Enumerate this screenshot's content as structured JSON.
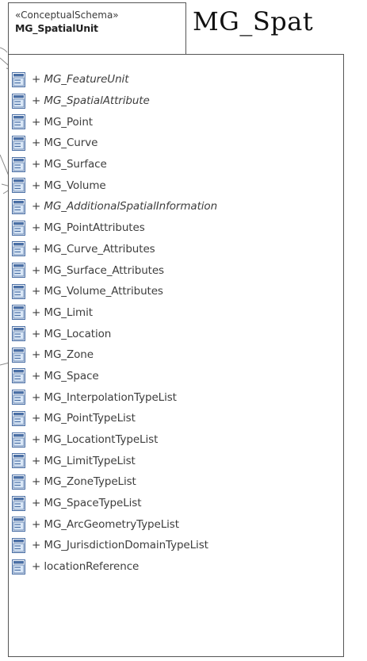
{
  "diagram_title": "MG_Spat",
  "package": {
    "stereotype": "«ConceptualSchema»",
    "name": "MG_SpatialUnit"
  },
  "elements": [
    {
      "label": "+ MG_FeatureUnit",
      "abstract": true
    },
    {
      "label": "+ MG_SpatialAttribute",
      "abstract": true
    },
    {
      "label": "+ MG_Point",
      "abstract": false
    },
    {
      "label": "+ MG_Curve",
      "abstract": false
    },
    {
      "label": "+ MG_Surface",
      "abstract": false
    },
    {
      "label": "+ MG_Volume",
      "abstract": false
    },
    {
      "label": "+ MG_AdditionalSpatialInformation",
      "abstract": true
    },
    {
      "label": "+ MG_PointAttributes",
      "abstract": false
    },
    {
      "label": "+ MG_Curve_Attributes",
      "abstract": false
    },
    {
      "label": "+ MG_Surface_Attributes",
      "abstract": false
    },
    {
      "label": "+ MG_Volume_Attributes",
      "abstract": false
    },
    {
      "label": "+ MG_Limit",
      "abstract": false
    },
    {
      "label": "+ MG_Location",
      "abstract": false
    },
    {
      "label": "+ MG_Zone",
      "abstract": false
    },
    {
      "label": "+ MG_Space",
      "abstract": false
    },
    {
      "label": "+ MG_InterpolationTypeList",
      "abstract": false
    },
    {
      "label": "+ MG_PointTypeList",
      "abstract": false
    },
    {
      "label": "+ MG_LocationtTypeList",
      "abstract": false
    },
    {
      "label": "+ MG_LimitTypeList",
      "abstract": false
    },
    {
      "label": "+ MG_ZoneTypeList",
      "abstract": false
    },
    {
      "label": "+ MG_SpaceTypeList",
      "abstract": false
    },
    {
      "label": "+ MG_ArcGeometryTypeList",
      "abstract": false
    },
    {
      "label": "+ MG_JurisdictionDomainTypeList",
      "abstract": false
    },
    {
      "label": "+ locationReference",
      "abstract": false
    }
  ],
  "icon": {
    "name": "class-icon",
    "border_color": "#4a6fa5",
    "fill_color": "#dbe8f7"
  }
}
